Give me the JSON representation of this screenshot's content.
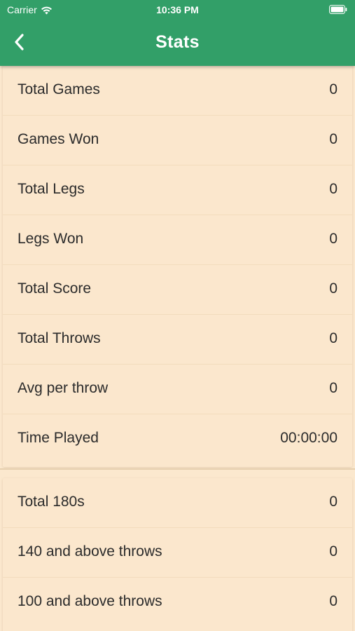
{
  "status_bar": {
    "carrier": "Carrier",
    "time": "10:36 PM"
  },
  "nav": {
    "title": "Stats",
    "back_icon": "chevron-left-icon"
  },
  "colors": {
    "header": "#329f68",
    "background": "#fbe8ce"
  },
  "stats_primary": [
    {
      "label": "Total Games",
      "value": "0"
    },
    {
      "label": "Games Won",
      "value": "0"
    },
    {
      "label": "Total Legs",
      "value": "0"
    },
    {
      "label": "Legs Won",
      "value": "0"
    },
    {
      "label": "Total Score",
      "value": "0"
    },
    {
      "label": "Total Throws",
      "value": "0"
    },
    {
      "label": "Avg per throw",
      "value": "0"
    },
    {
      "label": "Time Played",
      "value": "00:00:00"
    }
  ],
  "stats_secondary": [
    {
      "label": "Total 180s",
      "value": "0"
    },
    {
      "label": "140 and above throws",
      "value": "0"
    },
    {
      "label": "100 and above throws",
      "value": "0"
    }
  ]
}
